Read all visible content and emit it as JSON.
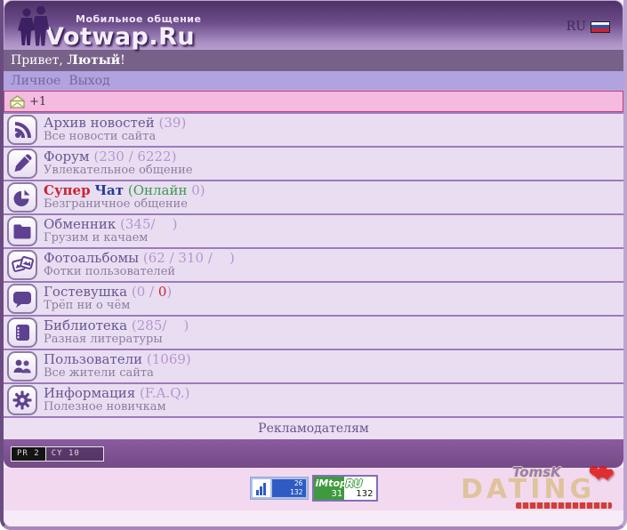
{
  "header": {
    "tagline": "Мобильное общение",
    "site_name": "Votwap.Ru",
    "lang_label": "RU"
  },
  "greeting": {
    "prefix": "Привет, ",
    "username": "Лютый",
    "suffix": "!"
  },
  "nav": {
    "links": [
      {
        "label": "Личное"
      },
      {
        "label": "Выход"
      }
    ]
  },
  "inbox": {
    "count_label": "+1"
  },
  "menu": [
    {
      "icon": "rss-icon",
      "title": "Архив новостей",
      "count": "(39)",
      "subtitle": "Все новости сайта"
    },
    {
      "icon": "pencil-icon",
      "title": "Форум",
      "count": "(230 / 6222)",
      "subtitle": "Увлекательное общение"
    },
    {
      "icon": "pie-chart-icon",
      "title_word1": "Супер",
      "title_word2": "Чат",
      "online_label": "(Онлайн",
      "online_value": "0)",
      "subtitle": "Безграничное общение"
    },
    {
      "icon": "folder-icon",
      "title": "Обменник",
      "count": "(345/    )",
      "subtitle": "Грузим и качаем"
    },
    {
      "icon": "photos-icon",
      "title": "Фотоальбомы",
      "count": "(62 / 310 /    )",
      "subtitle": "Фотки пользователей"
    },
    {
      "icon": "speech-bubble-icon",
      "title": "Гостевушка",
      "count_pre": "(0 /",
      "count_highlight": "0",
      "count_post": ")",
      "subtitle": "Трёп ни о чём"
    },
    {
      "icon": "book-icon",
      "title": "Библиотека",
      "count": "(285/    )",
      "subtitle": "Разная литературы"
    },
    {
      "icon": "users-icon",
      "title": "Пользователи",
      "count": "(1069)",
      "subtitle": "Все жители сайта"
    },
    {
      "icon": "gear-icon",
      "title": "Информация",
      "count": "(F.A.Q.)",
      "subtitle": "Полезное новичкам"
    }
  ],
  "advertisers": {
    "label": "Рекламодателям"
  },
  "seo_badge": {
    "pr": "PR 2",
    "cy": "CY 10"
  },
  "counters": {
    "stats_blue": {
      "top": "26",
      "bottom": "132"
    },
    "imtop": {
      "brand_left": "iMtop",
      "brand_right": "RU",
      "left_value": "31",
      "right_value": "132"
    }
  },
  "watermark": {
    "line1": "TomsK",
    "line2": "DATING"
  },
  "colors": {
    "accent": "#7c5190",
    "header_top": "#4e3166",
    "row_bg": "#e9def1",
    "separator": "#9d7abc",
    "alert_bg": "#f4badf",
    "alert_border": "#c3407a",
    "count_text": "#b595d2",
    "chat_red": "#cc2233",
    "chat_blue": "#223a99",
    "online_green": "#3a9a4a"
  }
}
